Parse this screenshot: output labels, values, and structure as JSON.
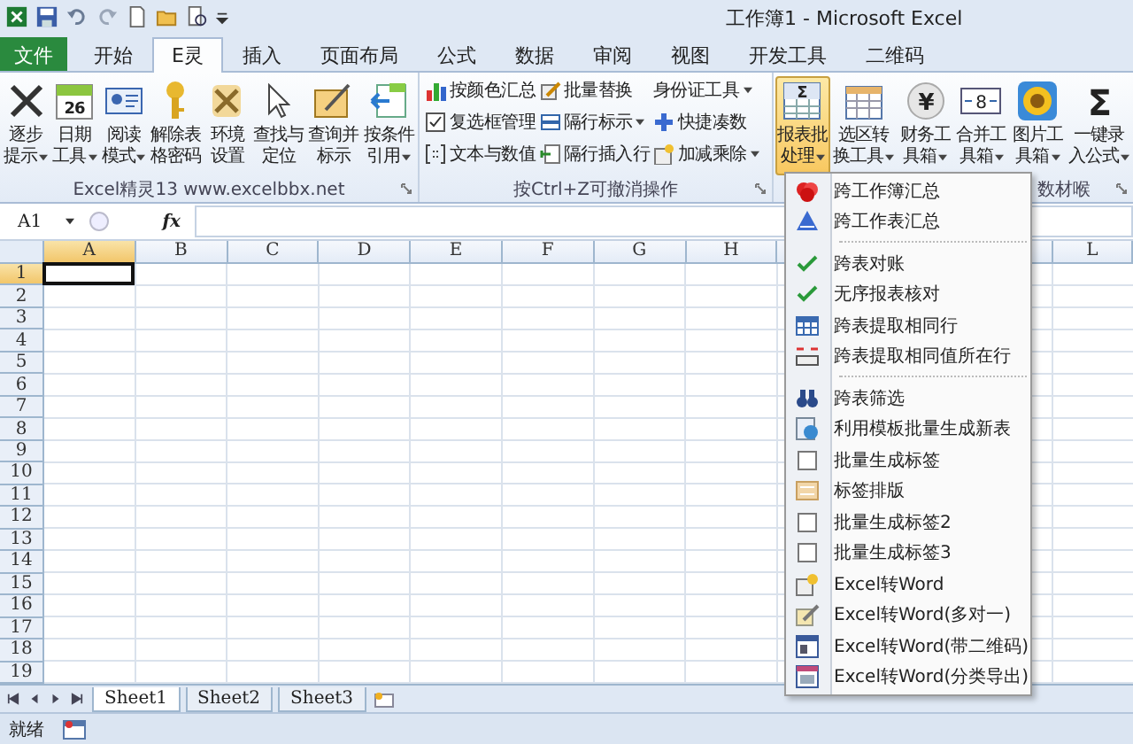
{
  "title_bar": {
    "title": "工作簿1 - Microsoft Excel"
  },
  "tabs": [
    {
      "label": "文件",
      "kind": "file",
      "selected": false
    },
    {
      "label": "开始",
      "kind": "tab",
      "selected": false
    },
    {
      "label": "E灵",
      "kind": "tab",
      "selected": true
    },
    {
      "label": "插入",
      "kind": "tab",
      "selected": false
    },
    {
      "label": "页面布局",
      "kind": "tab",
      "selected": false
    },
    {
      "label": "公式",
      "kind": "tab",
      "selected": false
    },
    {
      "label": "数据",
      "kind": "tab",
      "selected": false
    },
    {
      "label": "审阅",
      "kind": "tab",
      "selected": false
    },
    {
      "label": "视图",
      "kind": "tab",
      "selected": false
    },
    {
      "label": "开发工具",
      "kind": "tab",
      "selected": false
    },
    {
      "label": "二维码",
      "kind": "tab",
      "selected": false
    }
  ],
  "ribbon": {
    "groups": [
      {
        "label": "Excel精灵13   www.excelbbx.net",
        "kind": "large",
        "buttons": [
          {
            "line1": "逐步",
            "line2": "提示",
            "dropdown": true,
            "pressed": false
          },
          {
            "line1": "日期",
            "line2": "工具",
            "dropdown": true,
            "pressed": false,
            "glyph": "26"
          },
          {
            "line1": "阅读",
            "line2": "模式",
            "dropdown": true,
            "pressed": false
          },
          {
            "line1": "解除表",
            "line2": "格密码",
            "dropdown": false,
            "pressed": false
          },
          {
            "line1": "环境",
            "line2": "设置",
            "dropdown": false,
            "pressed": false
          },
          {
            "line1": "查找与",
            "line2": "定位",
            "dropdown": false,
            "pressed": false
          },
          {
            "line1": "查询并",
            "line2": "标示",
            "dropdown": false,
            "pressed": false
          },
          {
            "line1": "按条件",
            "line2": "引用",
            "dropdown": true,
            "pressed": false
          }
        ]
      },
      {
        "label": "按Ctrl+Z可撤消操作",
        "kind": "small",
        "buttons": [
          {
            "label": "按颜色汇总",
            "dropdown": false
          },
          {
            "label": "复选框管理",
            "dropdown": false
          },
          {
            "label": "文本与数值",
            "dropdown": false
          },
          {
            "label": "批量替换",
            "dropdown": false
          },
          {
            "label": "隔行标示",
            "dropdown": true
          },
          {
            "label": "隔行插入行",
            "dropdown": false
          },
          {
            "label": "身份证工具",
            "dropdown": true
          },
          {
            "label": "快捷凑数",
            "dropdown": false
          },
          {
            "label": "加减乘除",
            "dropdown": true
          }
        ]
      },
      {
        "label": "数材喉",
        "kind": "large",
        "buttons": [
          {
            "line1": "报表批",
            "line2": "处理",
            "dropdown": true,
            "pressed": true,
            "glyph": "Σ"
          },
          {
            "line1": "选区转",
            "line2": "换工具",
            "dropdown": true,
            "pressed": false
          },
          {
            "line1": "财务工",
            "line2": "具箱",
            "dropdown": true,
            "pressed": false,
            "glyph": "¥"
          },
          {
            "line1": "合并工",
            "line2": "具箱",
            "dropdown": true,
            "pressed": false,
            "glyph": "8"
          },
          {
            "line1": "图片工",
            "line2": "具箱",
            "dropdown": true,
            "pressed": false
          },
          {
            "line1": "一键录",
            "line2": "入公式",
            "dropdown": true,
            "pressed": false,
            "glyph": "Σ"
          }
        ]
      }
    ]
  },
  "formula_bar": {
    "name_box": "A1",
    "function_label": "fx"
  },
  "grid": {
    "columns_left": [
      {
        "label": "A",
        "selected": true
      },
      {
        "label": "B",
        "selected": false
      },
      {
        "label": "C",
        "selected": false
      },
      {
        "label": "D",
        "selected": false
      },
      {
        "label": "E",
        "selected": false
      },
      {
        "label": "F",
        "selected": false
      },
      {
        "label": "G",
        "selected": false
      },
      {
        "label": "H",
        "selected": false
      }
    ],
    "columns_right": [
      {
        "label": "L",
        "selected": false
      }
    ],
    "rows": [
      {
        "label": "1",
        "selected": true
      },
      {
        "label": "2",
        "selected": false
      },
      {
        "label": "3",
        "selected": false
      },
      {
        "label": "4",
        "selected": false
      },
      {
        "label": "5",
        "selected": false
      },
      {
        "label": "6",
        "selected": false
      },
      {
        "label": "7",
        "selected": false
      },
      {
        "label": "8",
        "selected": false
      },
      {
        "label": "9",
        "selected": false
      },
      {
        "label": "10",
        "selected": false
      },
      {
        "label": "11",
        "selected": false
      },
      {
        "label": "12",
        "selected": false
      },
      {
        "label": "13",
        "selected": false
      },
      {
        "label": "14",
        "selected": false
      },
      {
        "label": "15",
        "selected": false
      },
      {
        "label": "16",
        "selected": false
      },
      {
        "label": "17",
        "selected": false
      },
      {
        "label": "18",
        "selected": false
      },
      {
        "label": "19",
        "selected": false
      }
    ]
  },
  "menu": {
    "sections": [
      [
        "跨工作簿汇总",
        "跨工作表汇总"
      ],
      [
        "跨表对账",
        "无序报表核对",
        "跨表提取相同行",
        "跨表提取相同值所在行"
      ],
      [
        "跨表筛选",
        "利用模板批量生成新表",
        "批量生成标签",
        "标签排版",
        "批量生成标签2",
        "批量生成标签3",
        "Excel转Word",
        "Excel转Word(多对一)",
        "Excel转Word(带二维码)",
        "Excel转Word(分类导出)"
      ]
    ]
  },
  "sheet_tabs": [
    {
      "label": "Sheet1",
      "selected": true
    },
    {
      "label": "Sheet2",
      "selected": false
    },
    {
      "label": "Sheet3",
      "selected": false
    }
  ],
  "status_bar": {
    "text": "就绪"
  }
}
